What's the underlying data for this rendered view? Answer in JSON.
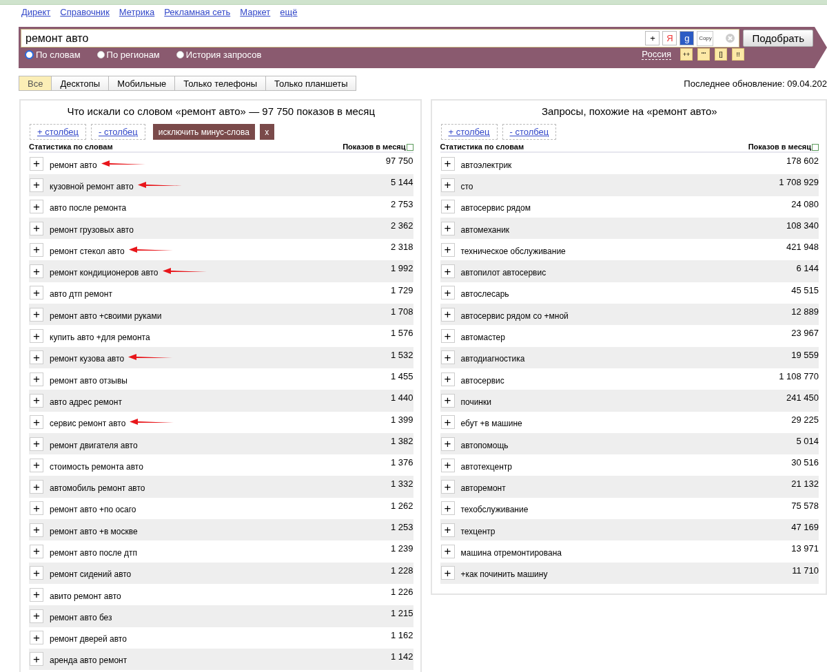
{
  "top_links": [
    "Директ",
    "Справочник",
    "Метрика",
    "Рекламная сеть",
    "Маркет",
    "ещё"
  ],
  "search": {
    "value": "ремонт авто",
    "plus": "+",
    "yandex": "Я",
    "google": "g",
    "copy": "Copy",
    "submit": "Подобрать",
    "region": "Россия",
    "operators": [
      "++",
      "\"\"",
      "[]",
      "!!"
    ]
  },
  "modes": [
    {
      "label": "По словам",
      "selected": true
    },
    {
      "label": "По регионам",
      "selected": false
    },
    {
      "label": "История запросов",
      "selected": false
    }
  ],
  "device_tabs": [
    {
      "label": "Все",
      "selected": true
    },
    {
      "label": "Десктопы",
      "selected": false
    },
    {
      "label": "Мобильные",
      "selected": false
    },
    {
      "label": "Только телефоны",
      "selected": false
    },
    {
      "label": "Только планшеты",
      "selected": false
    }
  ],
  "last_update": "Последнее обновление: 09.04.202",
  "left_panel": {
    "title": "Что искали со словом «ремонт авто» — 97 750 показов в месяц",
    "add_column": "+ столбец",
    "remove_column": "- столбец",
    "exclude": "исключить минус-слова",
    "exclude_close": "x",
    "add_symbol": "+",
    "col_words": "Статистика по словам",
    "col_count": "Показов в месяц",
    "rows": [
      {
        "phrase": "ремонт авто",
        "count": "97 750",
        "marked": true
      },
      {
        "phrase": "кузовной ремонт авто",
        "count": "5 144",
        "marked": true
      },
      {
        "phrase": "авто после ремонта",
        "count": "2 753",
        "marked": false
      },
      {
        "phrase": "ремонт грузовых авто",
        "count": "2 362",
        "marked": false
      },
      {
        "phrase": "ремонт стекол авто",
        "count": "2 318",
        "marked": true
      },
      {
        "phrase": "ремонт кондиционеров авто",
        "count": "1 992",
        "marked": true
      },
      {
        "phrase": "авто дтп ремонт",
        "count": "1 729",
        "marked": false
      },
      {
        "phrase": "ремонт авто +своими руками",
        "count": "1 708",
        "marked": false
      },
      {
        "phrase": "купить авто +для ремонта",
        "count": "1 576",
        "marked": false
      },
      {
        "phrase": "ремонт кузова авто",
        "count": "1 532",
        "marked": true
      },
      {
        "phrase": "ремонт авто отзывы",
        "count": "1 455",
        "marked": false
      },
      {
        "phrase": "авто адрес ремонт",
        "count": "1 440",
        "marked": false
      },
      {
        "phrase": "сервис ремонт авто",
        "count": "1 399",
        "marked": true
      },
      {
        "phrase": "ремонт двигателя авто",
        "count": "1 382",
        "marked": false
      },
      {
        "phrase": "стоимость ремонта авто",
        "count": "1 376",
        "marked": false
      },
      {
        "phrase": "автомобиль ремонт авто",
        "count": "1 332",
        "marked": false
      },
      {
        "phrase": "ремонт авто +по осаго",
        "count": "1 262",
        "marked": false
      },
      {
        "phrase": "ремонт авто +в москве",
        "count": "1 253",
        "marked": false
      },
      {
        "phrase": "ремонт авто после дтп",
        "count": "1 239",
        "marked": false
      },
      {
        "phrase": "ремонт сидений авто",
        "count": "1 228",
        "marked": false
      },
      {
        "phrase": "авито ремонт авто",
        "count": "1 226",
        "marked": false
      },
      {
        "phrase": "ремонт авто без",
        "count": "1 215",
        "marked": false
      },
      {
        "phrase": "ремонт дверей авто",
        "count": "1 162",
        "marked": false
      },
      {
        "phrase": "аренда авто ремонт",
        "count": "1 142",
        "marked": false
      }
    ]
  },
  "right_panel": {
    "title": "Запросы, похожие на «ремонт авто»",
    "add_column": "+ столбец",
    "remove_column": "- столбец",
    "add_symbol": "+",
    "col_words": "Статистика по словам",
    "col_count": "Показов в месяц",
    "rows": [
      {
        "phrase": "автоэлектрик",
        "count": "178 602"
      },
      {
        "phrase": "сто",
        "count": "1 708 929"
      },
      {
        "phrase": "автосервис рядом",
        "count": "24 080"
      },
      {
        "phrase": "автомеханик",
        "count": "108 340"
      },
      {
        "phrase": "техническое обслуживание",
        "count": "421 948"
      },
      {
        "phrase": "автопилот автосервис",
        "count": "6 144"
      },
      {
        "phrase": "автослесарь",
        "count": "45 515"
      },
      {
        "phrase": "автосервис рядом со +мной",
        "count": "12 889"
      },
      {
        "phrase": "автомастер",
        "count": "23 967"
      },
      {
        "phrase": "автодиагностика",
        "count": "19 559"
      },
      {
        "phrase": "автосервис",
        "count": "1 108 770"
      },
      {
        "phrase": "починки",
        "count": "241 450"
      },
      {
        "phrase": "ебут +в машине",
        "count": "29 225"
      },
      {
        "phrase": "автопомощь",
        "count": "5 014"
      },
      {
        "phrase": "автотехцентр",
        "count": "30 516"
      },
      {
        "phrase": "авторемонт",
        "count": "21 132"
      },
      {
        "phrase": "техобслуживание",
        "count": "75 578"
      },
      {
        "phrase": "техцентр",
        "count": "47 169"
      },
      {
        "phrase": "машина отремонтирована",
        "count": "13 971"
      },
      {
        "phrase": "+как починить машину",
        "count": "11 710"
      }
    ]
  }
}
